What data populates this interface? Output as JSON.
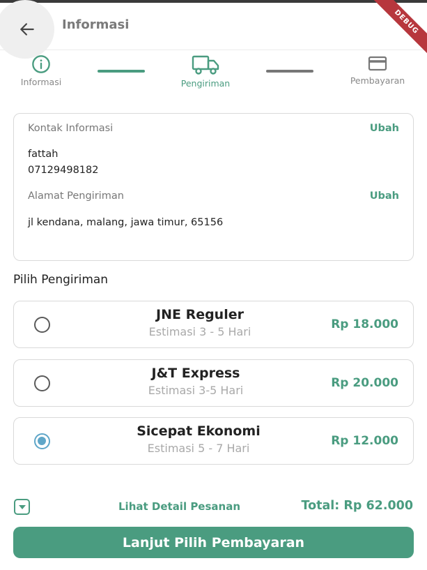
{
  "appbar": {
    "title": "Informasi",
    "debug_label": "DEBUG"
  },
  "stepper": {
    "steps": [
      {
        "label": "Informasi",
        "icon": "info-circle-icon",
        "state": "done"
      },
      {
        "label": "Pengiriman",
        "icon": "truck-icon",
        "state": "active"
      },
      {
        "label": "Pembayaran",
        "icon": "credit-card-icon",
        "state": "pending"
      }
    ]
  },
  "contact": {
    "title": "Kontak Informasi",
    "edit_label": "Ubah",
    "name": "fattah",
    "phone": "07129498182",
    "address_title": "Alamat Pengiriman",
    "address_edit_label": "Ubah",
    "address": "jl kendana, malang, jawa timur, 65156"
  },
  "shipping": {
    "title": "Pilih Pengiriman",
    "options": [
      {
        "name": "JNE Reguler",
        "estimate": "Estimasi 3 - 5 Hari",
        "price": "Rp 18.000",
        "selected": false
      },
      {
        "name": "J&T Express",
        "estimate": "Estimasi 3-5 Hari",
        "price": "Rp 20.000",
        "selected": false
      },
      {
        "name": "Sicepat Ekonomi",
        "estimate": "Estimasi 5 - 7 Hari",
        "price": "Rp 12.000",
        "selected": true
      }
    ]
  },
  "footer": {
    "detail_label": "Lihat Detail Pesanan",
    "total": "Total: Rp 62.000",
    "cta_label": "Lanjut Pilih Pembayaran"
  },
  "colors": {
    "accent": "#4a9c80",
    "radio_selected": "#5fa6c8",
    "debug": "#b7373d"
  }
}
